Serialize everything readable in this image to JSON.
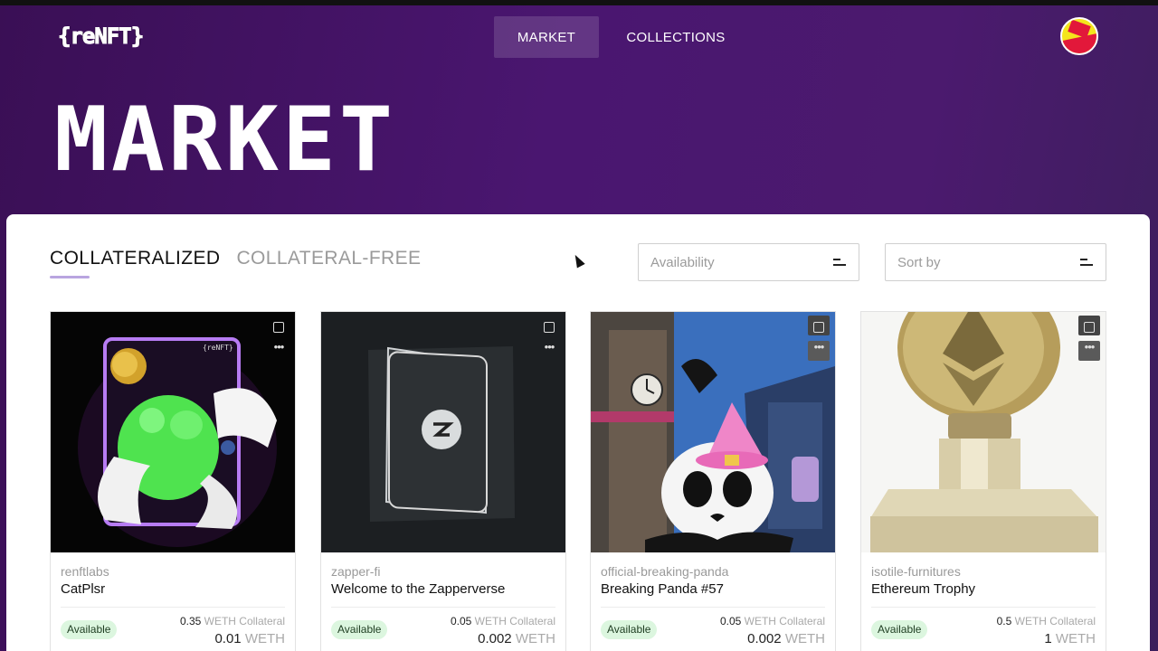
{
  "header": {
    "logo": "{reNFT}",
    "nav": [
      {
        "label": "MARKET",
        "active": true
      },
      {
        "label": "COLLECTIONS",
        "active": false
      }
    ],
    "page_title": "MARKET"
  },
  "tabs": [
    {
      "label": "COLLATERALIZED",
      "active": true
    },
    {
      "label": "COLLATERAL-FREE",
      "active": false
    }
  ],
  "filters": {
    "availability_placeholder": "Availability",
    "sort_placeholder": "Sort by"
  },
  "cards": [
    {
      "collection": "renftlabs",
      "name": "CatPlsr",
      "status": "Available",
      "collateral_amount": "0.35",
      "collateral_unit": "WETH Collateral",
      "price_amount": "0.01",
      "price_unit": "WETH"
    },
    {
      "collection": "zapper-fi",
      "name": "Welcome to the Zapperverse",
      "status": "Available",
      "collateral_amount": "0.05",
      "collateral_unit": "WETH Collateral",
      "price_amount": "0.002",
      "price_unit": "WETH"
    },
    {
      "collection": "official-breaking-panda",
      "name": "Breaking Panda #57",
      "status": "Available",
      "collateral_amount": "0.05",
      "collateral_unit": "WETH Collateral",
      "price_amount": "0.002",
      "price_unit": "WETH"
    },
    {
      "collection": "isotile-furnitures",
      "name": "Ethereum Trophy",
      "status": "Available",
      "collateral_amount": "0.5",
      "collateral_unit": "WETH Collateral",
      "price_amount": "1",
      "price_unit": "WETH"
    }
  ]
}
